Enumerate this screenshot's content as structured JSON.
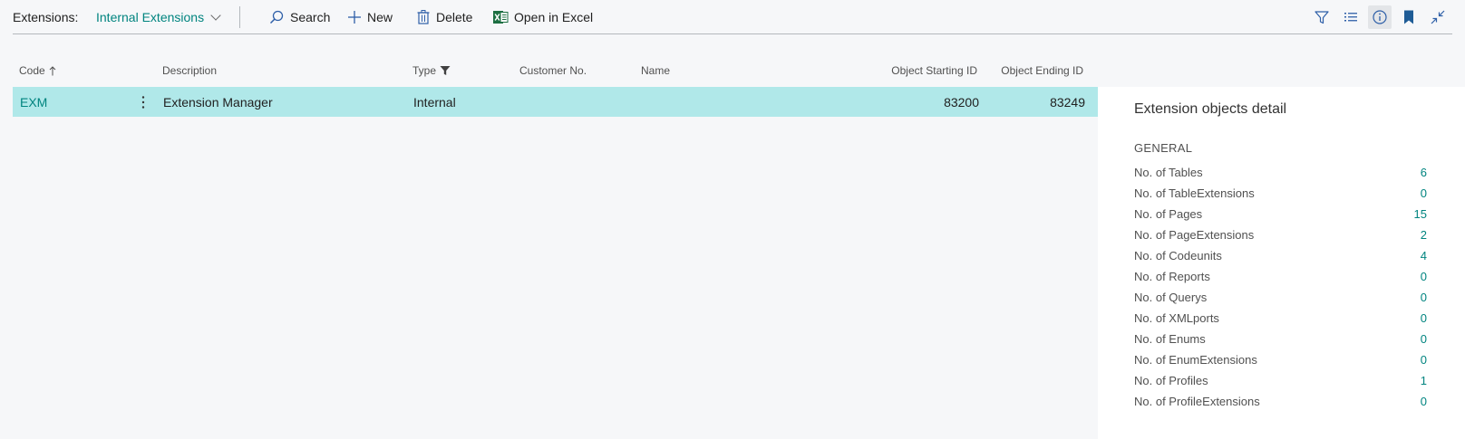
{
  "actionbar": {
    "title": "Extensions:",
    "view": "Internal Extensions",
    "search_label": "Search",
    "new_label": "New",
    "delete_label": "Delete",
    "excel_label": "Open in Excel"
  },
  "colors": {
    "accent": "#00847f",
    "selected_row": "#b0e8e9",
    "page_bg": "#f6f7f9",
    "excel_green": "#1d6f42"
  },
  "grid": {
    "columns": {
      "code": "Code",
      "description": "Description",
      "type": "Type",
      "customer_no": "Customer No.",
      "name": "Name",
      "object_starting_id": "Object Starting ID",
      "object_ending_id": "Object Ending ID"
    },
    "rows": [
      {
        "code": "EXM",
        "description": "Extension Manager",
        "type": "Internal",
        "customer_no": "",
        "name": "",
        "object_starting_id": "83200",
        "object_ending_id": "83249"
      }
    ]
  },
  "factbox": {
    "title": "Extension objects detail",
    "section": "GENERAL",
    "rows": [
      {
        "label": "No. of Tables",
        "value": "6"
      },
      {
        "label": "No. of TableExtensions",
        "value": "0"
      },
      {
        "label": "No. of Pages",
        "value": "15"
      },
      {
        "label": "No. of PageExtensions",
        "value": "2"
      },
      {
        "label": "No. of Codeunits",
        "value": "4"
      },
      {
        "label": "No. of Reports",
        "value": "0"
      },
      {
        "label": "No. of Querys",
        "value": "0"
      },
      {
        "label": "No. of XMLports",
        "value": "0"
      },
      {
        "label": "No. of Enums",
        "value": "0"
      },
      {
        "label": "No. of EnumExtensions",
        "value": "0"
      },
      {
        "label": "No. of Profiles",
        "value": "1"
      },
      {
        "label": "No. of ProfileExtensions",
        "value": "0"
      }
    ]
  },
  "icons": {
    "search": "search-icon",
    "new": "plus-icon",
    "delete": "trash-icon",
    "excel": "excel-icon",
    "filter": "filter-icon",
    "list": "list-icon",
    "info": "info-icon",
    "bookmark": "bookmark-icon",
    "collapse": "collapse-icon",
    "sort": "sort-ascending-icon",
    "type_filter": "filter-applied-icon",
    "row_menu": "more-vertical-icon"
  }
}
